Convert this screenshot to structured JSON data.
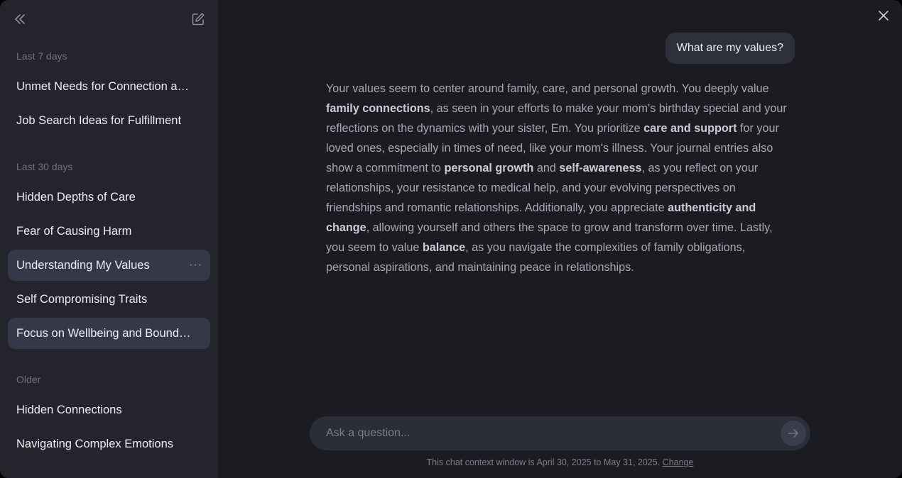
{
  "sidebar": {
    "sections": [
      {
        "label": "Last 7 days"
      },
      {
        "label": "Last 30 days"
      },
      {
        "label": "Older"
      }
    ],
    "items": [
      {
        "label": "Unmet Needs for Connection and Support"
      },
      {
        "label": "Job Search Ideas for Fulfillment"
      },
      {
        "label": "Hidden Depths of Care"
      },
      {
        "label": "Fear of Causing Harm"
      },
      {
        "label": "Understanding My Values",
        "menu": "···"
      },
      {
        "label": "Self Compromising Traits"
      },
      {
        "label": "Focus on Wellbeing and Boundaries"
      },
      {
        "label": "Hidden Connections"
      },
      {
        "label": "Navigating Complex Emotions"
      }
    ]
  },
  "chat": {
    "user_message": "What are my values?",
    "assistant": {
      "p1": "Your values seem to center around family, care, and personal growth. You deeply value ",
      "b1": "family connections",
      "p2": ", as seen in your efforts to make your mom's birthday special and your reflections on the dynamics with your sister, Em. You prioritize ",
      "b2": "care and support",
      "p3": " for your loved ones, especially in times of need, like your mom's illness. Your journal entries also show a commitment to ",
      "b3": "personal growth",
      "p4": " and ",
      "b4": "self-awareness",
      "p5": ", as you reflect on your relationships, your resistance to medical help, and your evolving perspectives on friendships and romantic relationships. Additionally, you appreciate ",
      "b5": "authenticity and change",
      "p6": ", allowing yourself and others the space to grow and transform over time. Lastly, you seem to value ",
      "b6": "balance",
      "p7": ", as you navigate the complexities of family obligations, personal aspirations, and maintaining peace in relationships."
    }
  },
  "composer": {
    "placeholder": "Ask a question...",
    "value": ""
  },
  "context_note": {
    "text": "This chat context window is April 30, 2025 to May 31, 2025. ",
    "link": "Change"
  },
  "icons": {
    "collapse": "double-chevron-left-icon",
    "new_chat": "edit-icon",
    "close": "close-icon",
    "send": "arrow-right-icon"
  }
}
